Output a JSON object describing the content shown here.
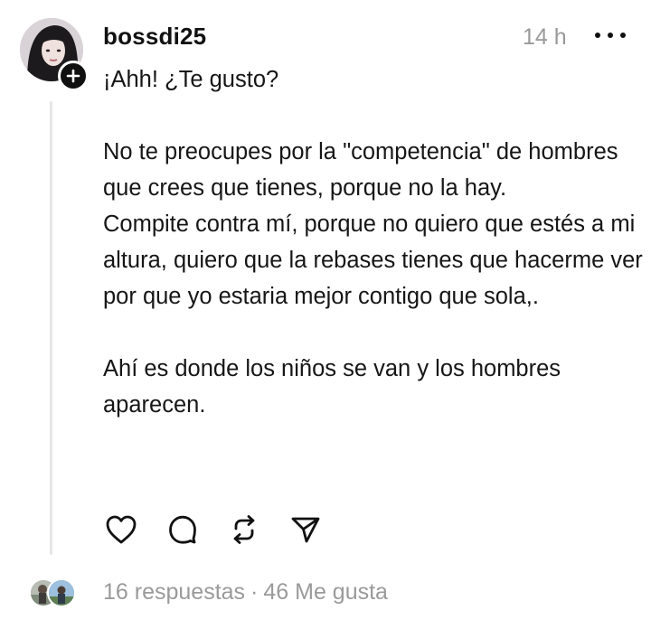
{
  "post": {
    "username": "bossdi25",
    "time": "14 h",
    "paragraphs": [
      "¡Ahh! ¿Te gusto?",
      "",
      "No te preocupes por la \"competencia\" de hombres que crees que tienes, porque no la hay.",
      "Compite contra mí, porque no quiero que estés a mi altura, quiero que la rebases tienes que hacerme ver por que yo estaria mejor contigo que sola,.",
      "",
      "Ahí es donde los niños se van y los hombres aparecen."
    ]
  },
  "footer": {
    "replies": "16 respuestas",
    "separator": "·",
    "likes": "46 Me gusta"
  },
  "icons": {
    "follow": "plus-icon",
    "more": "more-icon",
    "like": "heart-icon",
    "reply": "comment-icon",
    "repost": "repost-icon",
    "share": "send-icon"
  },
  "colors": {
    "text": "#161616",
    "muted": "#999999",
    "thread_line": "#e6e6e6"
  }
}
